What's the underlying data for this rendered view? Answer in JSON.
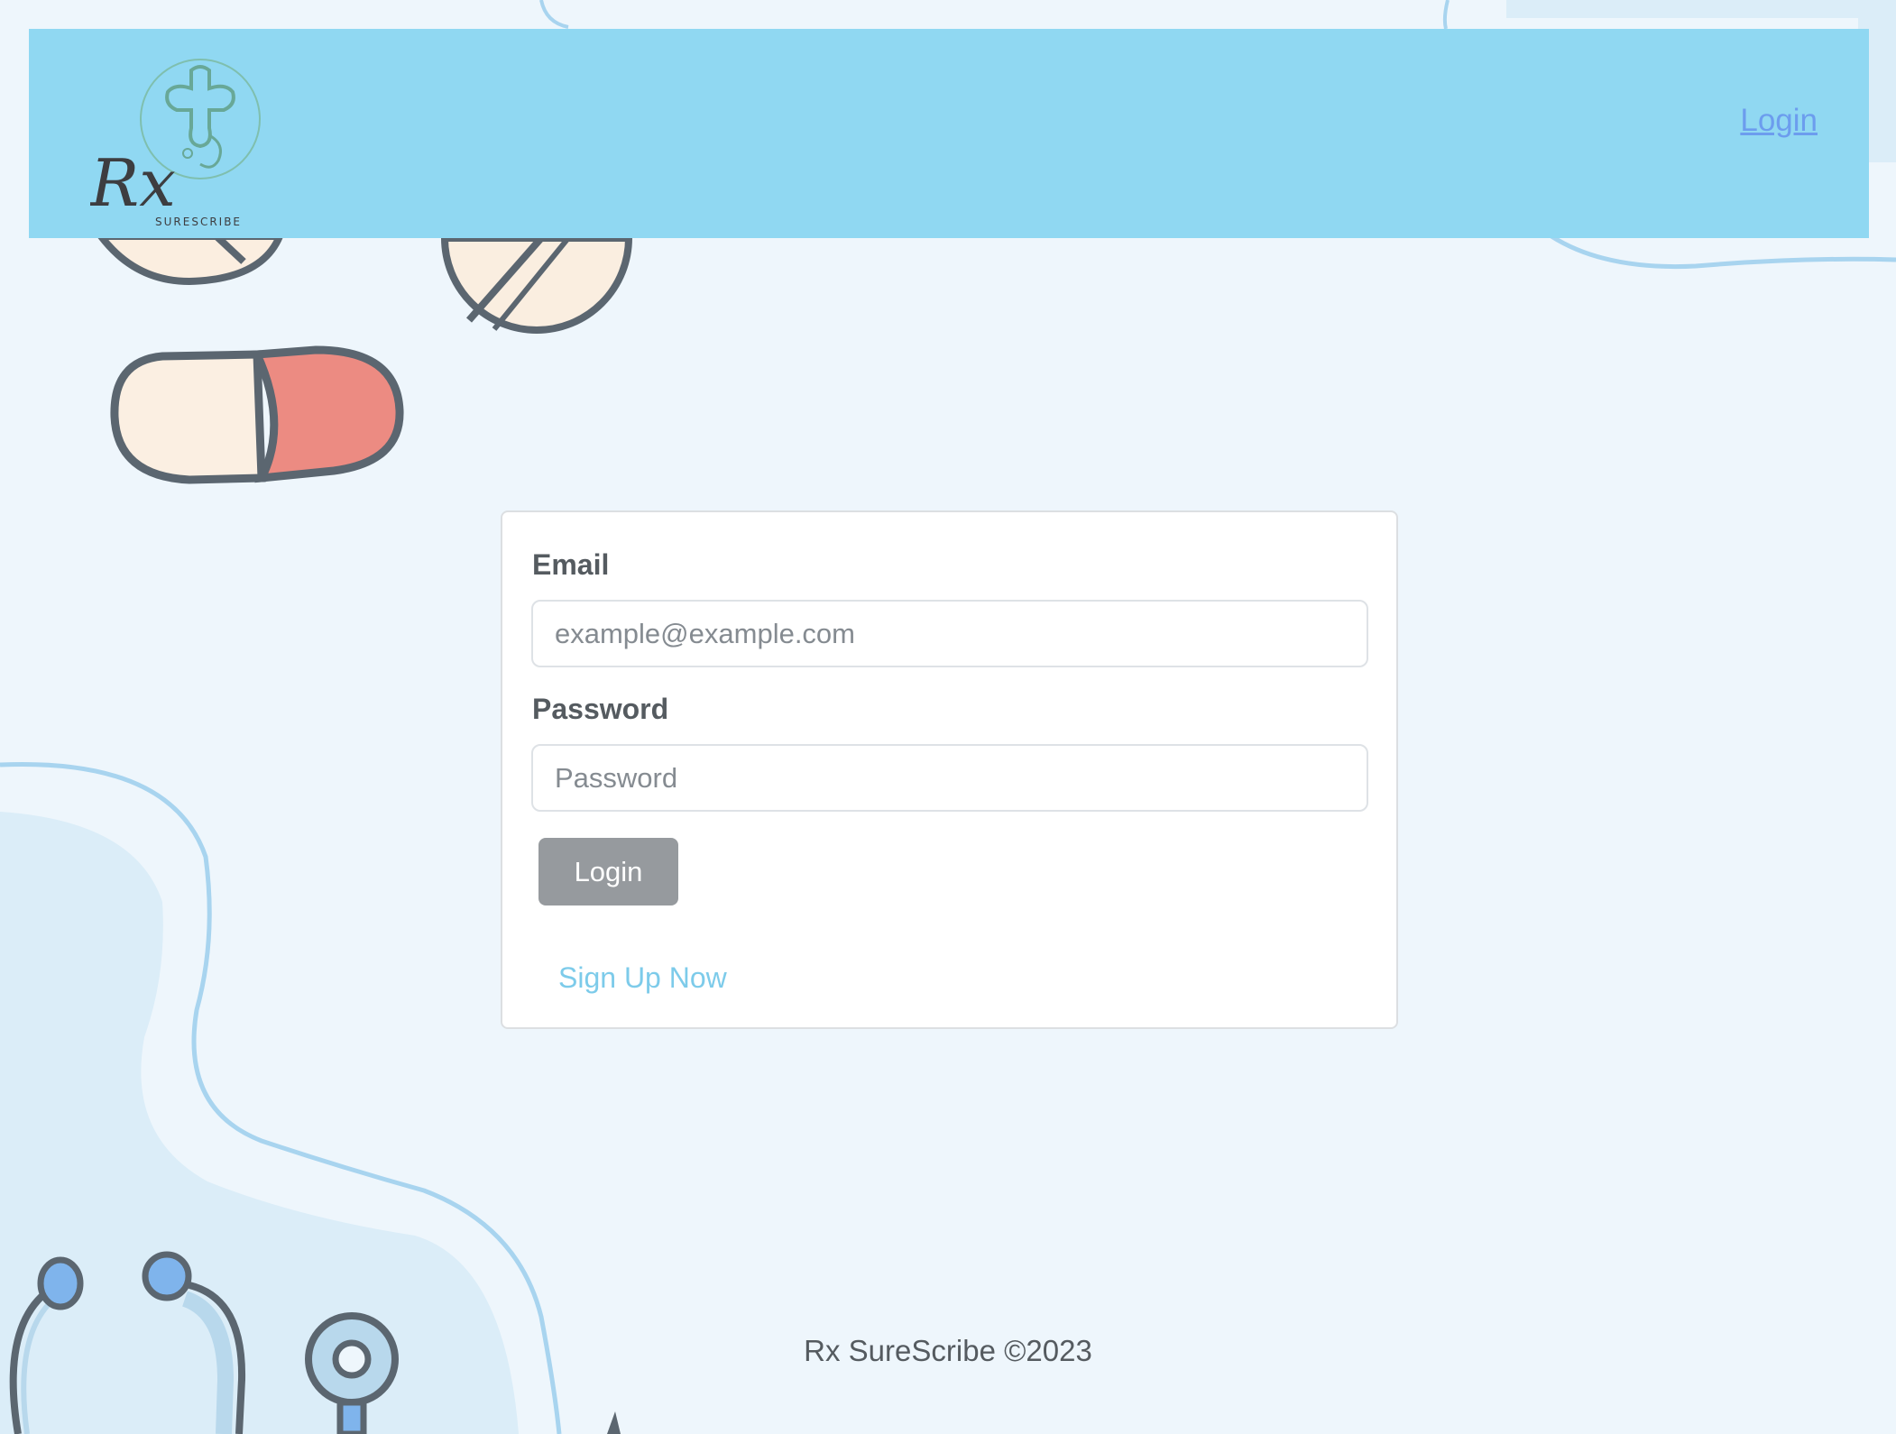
{
  "navbar": {
    "logo_text": "Rx",
    "logo_subtext": "SURESCRIBE",
    "login_link": "Login"
  },
  "form": {
    "email_label": "Email",
    "email_placeholder": "example@example.com",
    "email_value": "",
    "password_label": "Password",
    "password_placeholder": "Password",
    "password_value": "",
    "login_button": "Login",
    "signup_link": "Sign Up Now"
  },
  "footer": {
    "text": "Rx SureScribe ©2023"
  },
  "colors": {
    "navbar_bg": "#90d8f2",
    "page_bg": "#eef6fc",
    "link": "#6c9dee",
    "signup_link": "#7dcbea",
    "button_bg": "#969a9e"
  }
}
